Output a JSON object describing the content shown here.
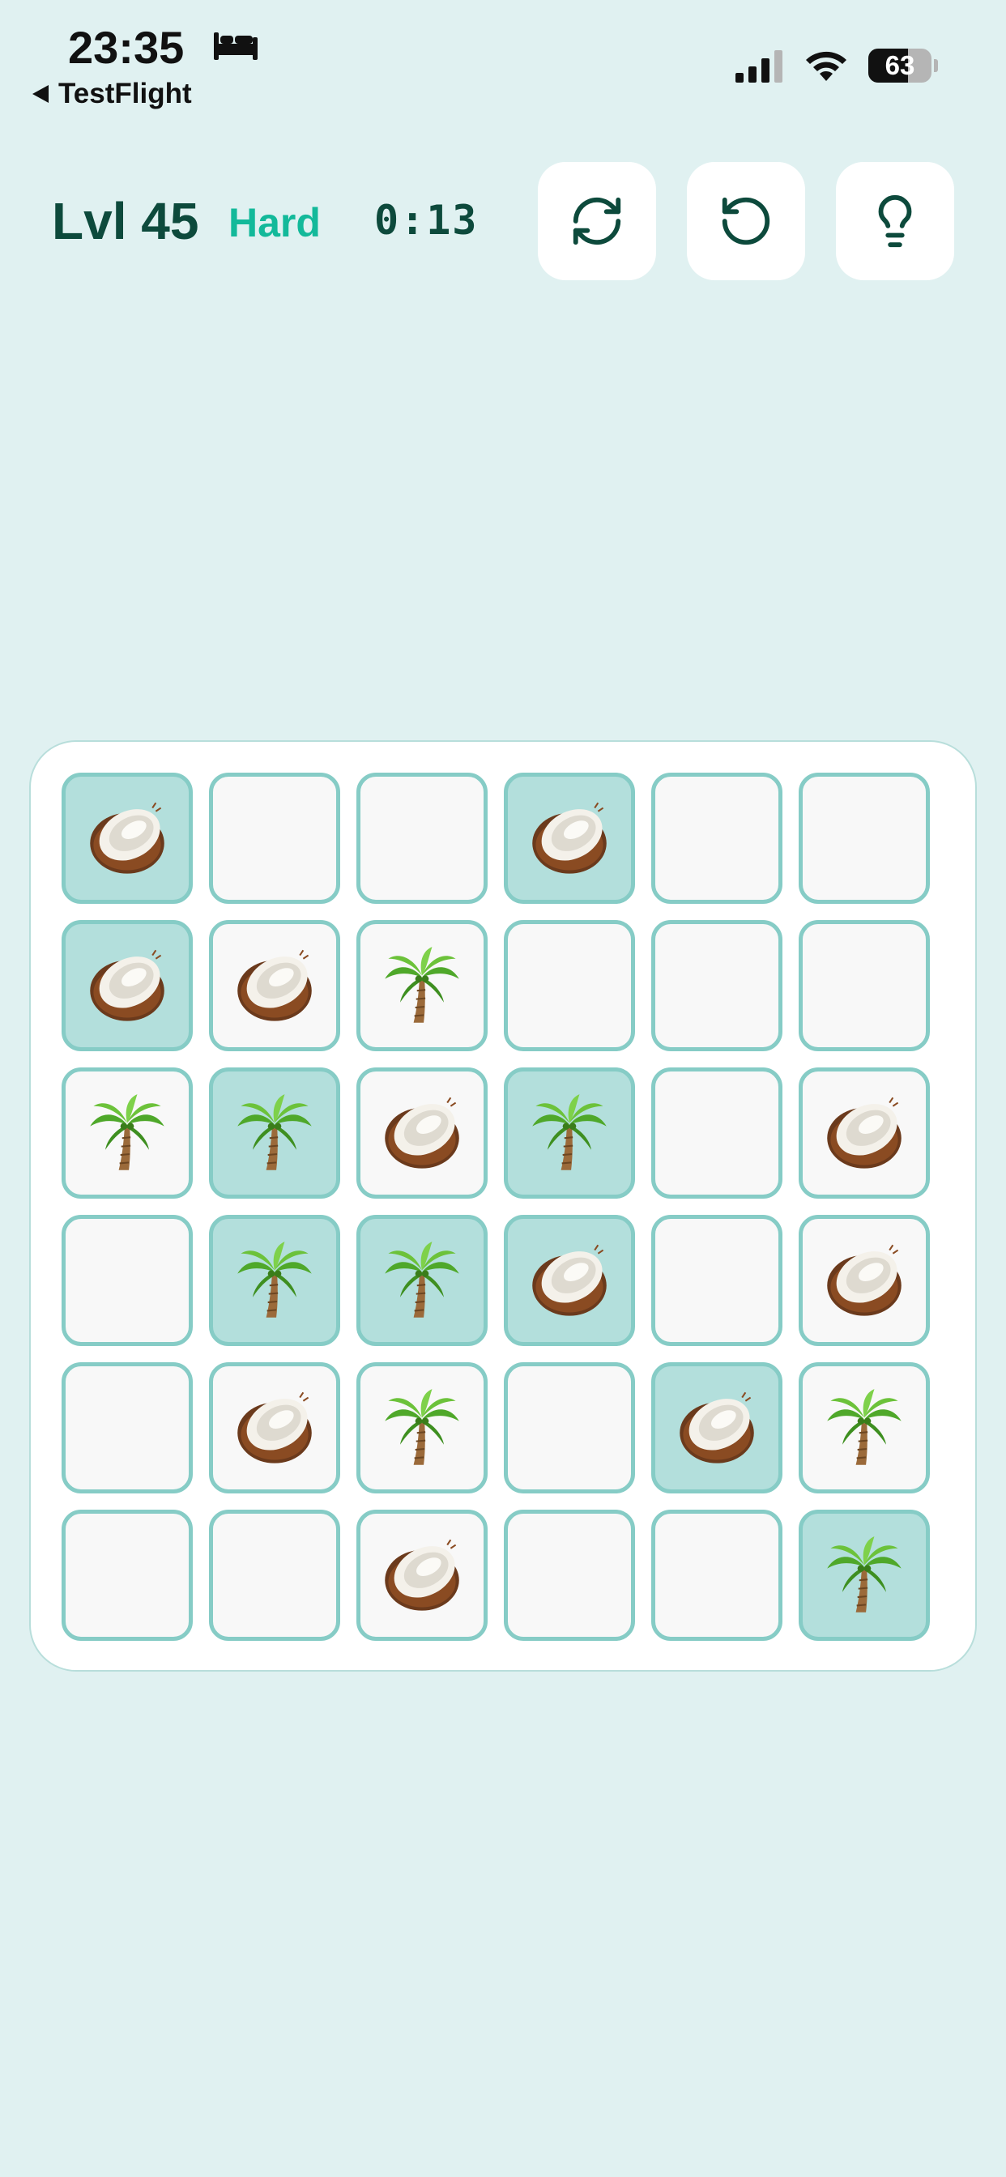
{
  "status_bar": {
    "time": "23:35",
    "back_label": "TestFlight",
    "battery_level": "63",
    "battery_fraction": 0.63
  },
  "header": {
    "level": "Lvl 45",
    "difficulty": "Hard",
    "timer": "0:13",
    "buttons": [
      {
        "name": "restart-button",
        "icon": "refresh-icon"
      },
      {
        "name": "undo-button",
        "icon": "undo-icon"
      },
      {
        "name": "hint-button",
        "icon": "lightbulb-icon"
      }
    ]
  },
  "colors": {
    "background": "#e0f1f1",
    "level_text": "#0d4a3c",
    "difficulty_text": "#13b99a",
    "cell_border": "#86ccc6",
    "cell_locked": "#b3dfdc",
    "cell_empty": "#f8f8f8"
  },
  "board": {
    "rows": 6,
    "cols": 6,
    "cells": [
      [
        {
          "v": "coconut",
          "locked": true
        },
        {
          "v": "",
          "locked": false
        },
        {
          "v": "",
          "locked": false
        },
        {
          "v": "coconut",
          "locked": true
        },
        {
          "v": "",
          "locked": false
        },
        {
          "v": "",
          "locked": false
        }
      ],
      [
        {
          "v": "coconut",
          "locked": true
        },
        {
          "v": "coconut",
          "locked": false
        },
        {
          "v": "palm",
          "locked": false
        },
        {
          "v": "",
          "locked": false
        },
        {
          "v": "",
          "locked": false
        },
        {
          "v": "",
          "locked": false
        }
      ],
      [
        {
          "v": "palm",
          "locked": false
        },
        {
          "v": "palm",
          "locked": true
        },
        {
          "v": "coconut",
          "locked": false
        },
        {
          "v": "palm",
          "locked": true
        },
        {
          "v": "",
          "locked": false
        },
        {
          "v": "coconut",
          "locked": false
        }
      ],
      [
        {
          "v": "",
          "locked": false
        },
        {
          "v": "palm",
          "locked": true
        },
        {
          "v": "palm",
          "locked": true
        },
        {
          "v": "coconut",
          "locked": true
        },
        {
          "v": "",
          "locked": false
        },
        {
          "v": "coconut",
          "locked": false
        }
      ],
      [
        {
          "v": "",
          "locked": false
        },
        {
          "v": "coconut",
          "locked": false
        },
        {
          "v": "palm",
          "locked": false
        },
        {
          "v": "",
          "locked": false
        },
        {
          "v": "coconut",
          "locked": true
        },
        {
          "v": "palm",
          "locked": false
        }
      ],
      [
        {
          "v": "",
          "locked": false
        },
        {
          "v": "",
          "locked": false
        },
        {
          "v": "coconut",
          "locked": false
        },
        {
          "v": "",
          "locked": false
        },
        {
          "v": "",
          "locked": false
        },
        {
          "v": "palm",
          "locked": true
        }
      ]
    ]
  }
}
